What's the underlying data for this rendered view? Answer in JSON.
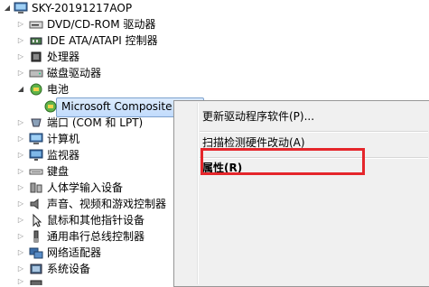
{
  "tree": {
    "root": "SKY-20191217AOP",
    "items": [
      {
        "label": "DVD/CD-ROM 驱动器",
        "icon": "dvd-drive-icon"
      },
      {
        "label": "IDE ATA/ATAPI 控制器",
        "icon": "ide-controller-icon"
      },
      {
        "label": "处理器",
        "icon": "processor-icon"
      },
      {
        "label": "磁盘驱动器",
        "icon": "disk-drive-icon"
      },
      {
        "label": "电池",
        "icon": "battery-icon",
        "expanded": true
      },
      {
        "label": "Microsoft Composite Ba",
        "icon": "battery-device-icon",
        "selected": true
      },
      {
        "label": "端口 (COM 和 LPT)",
        "icon": "port-icon"
      },
      {
        "label": "计算机",
        "icon": "computer-icon"
      },
      {
        "label": "监视器",
        "icon": "monitor-icon"
      },
      {
        "label": "键盘",
        "icon": "keyboard-icon"
      },
      {
        "label": "人体学输入设备",
        "icon": "hid-icon"
      },
      {
        "label": "声音、视频和游戏控制器",
        "icon": "sound-icon"
      },
      {
        "label": "鼠标和其他指针设备",
        "icon": "mouse-icon"
      },
      {
        "label": "通用串行总线控制器",
        "icon": "usb-icon"
      },
      {
        "label": "网络适配器",
        "icon": "network-adapter-icon"
      },
      {
        "label": "系统设备",
        "icon": "system-device-icon"
      }
    ]
  },
  "context_menu": {
    "items": [
      "更新驱动程序软件(P)...",
      "扫描检测硬件改动(A)",
      "属性(R)"
    ]
  },
  "colors": {
    "highlight_border": "#e5262b",
    "selection_fill": "#c1dbfc",
    "menu_bg": "#f0f0f0"
  }
}
